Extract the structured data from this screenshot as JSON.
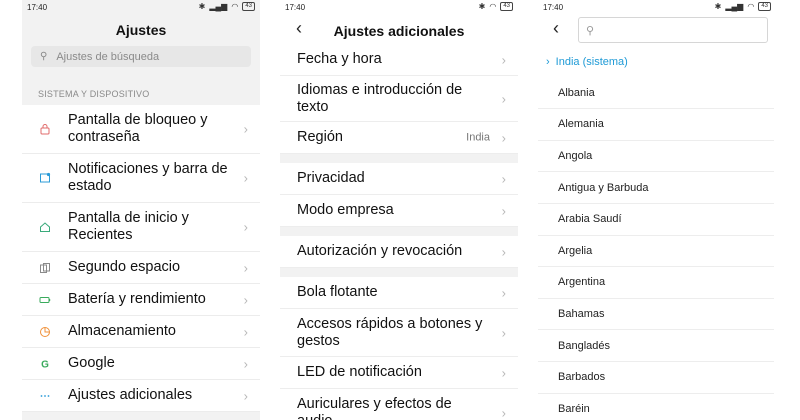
{
  "status_time": "17:40",
  "battery": "43",
  "screen1": {
    "title": "Ajustes",
    "search_placeholder": "Ajustes de búsqueda",
    "section_header": "SISTEMA Y DISPOSITIVO",
    "items": [
      {
        "label": "Pantalla de bloqueo y contraseña",
        "icon": "lock-icon",
        "color": "#e06b6b"
      },
      {
        "label": "Notificaciones y barra de estado",
        "icon": "notification-icon",
        "color": "#2b9bd7"
      },
      {
        "label": "Pantalla de inicio y Recientes",
        "icon": "home-icon",
        "color": "#3aaa7b"
      },
      {
        "label": "Segundo espacio",
        "icon": "second-space-icon",
        "color": "#8a8a8a"
      },
      {
        "label": "Batería y rendimiento",
        "icon": "battery-icon",
        "color": "#3aaa5c"
      },
      {
        "label": "Almacenamiento",
        "icon": "storage-icon",
        "color": "#f0913a"
      },
      {
        "label": "Google",
        "icon": "google-icon",
        "color": "#3aaa5c"
      },
      {
        "label": "Ajustes adicionales",
        "icon": "more-icon",
        "color": "#2b9bd7"
      }
    ]
  },
  "screen2": {
    "title": "Ajustes adicionales",
    "groups": [
      [
        {
          "label": "Fecha y hora",
          "value": ""
        },
        {
          "label": "Idiomas e introducción de texto",
          "value": ""
        },
        {
          "label": "Región",
          "value": "India"
        }
      ],
      [
        {
          "label": "Privacidad",
          "value": ""
        },
        {
          "label": "Modo empresa",
          "value": ""
        }
      ],
      [
        {
          "label": "Autorización y revocación",
          "value": ""
        }
      ],
      [
        {
          "label": "Bola flotante",
          "value": ""
        },
        {
          "label": "Accesos rápidos a botones y gestos",
          "value": ""
        },
        {
          "label": "LED de notificación",
          "value": ""
        },
        {
          "label": "Auriculares y efectos de audio",
          "value": ""
        }
      ]
    ]
  },
  "screen3": {
    "selected": "India (sistema)",
    "countries": [
      "Albania",
      "Alemania",
      "Angola",
      "Antigua y Barbuda",
      "Arabia Saudí",
      "Argelia",
      "Argentina",
      "Bahamas",
      "Bangladés",
      "Barbados",
      "Baréin"
    ]
  }
}
